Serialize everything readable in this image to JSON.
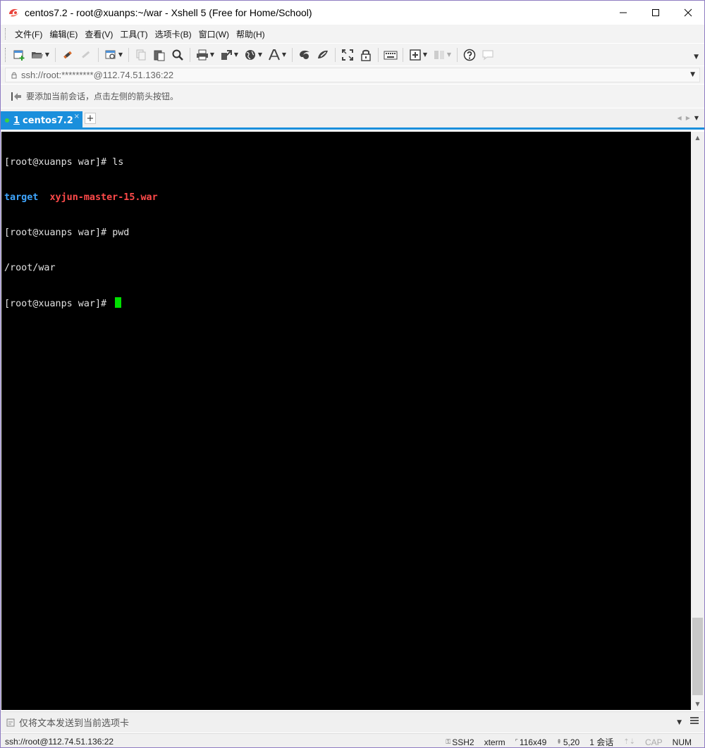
{
  "window": {
    "title": "centos7.2 - root@xuanps:~/war - Xshell 5 (Free for Home/School)"
  },
  "menu": {
    "items": [
      "文件(F)",
      "编辑(E)",
      "查看(V)",
      "工具(T)",
      "选项卡(B)",
      "窗口(W)",
      "帮助(H)"
    ]
  },
  "toolbar": {
    "icons": [
      "new-session-icon",
      "open-folder-icon",
      "connect-icon",
      "disconnect-icon",
      "properties-icon",
      "copy-icon",
      "paste-icon",
      "find-icon",
      "print-icon",
      "transfer-icon",
      "globe-icon",
      "font-icon",
      "xftp-icon",
      "xmanager-icon",
      "fullscreen-icon",
      "lock-icon",
      "keyboard-icon",
      "new-tab-icon",
      "layout-icon",
      "help-icon",
      "chat-icon"
    ]
  },
  "address": {
    "value": "ssh://root:*********@112.74.51.136:22"
  },
  "hint": {
    "text": "要添加当前会话，点击左侧的箭头按钮。"
  },
  "tabs": [
    {
      "number": "1",
      "label": "centos7.2",
      "close": "×",
      "active": true
    }
  ],
  "tab_add_label": "+",
  "terminal": {
    "lines": [
      {
        "prompt": "[root@xuanps war]# ",
        "command": "ls"
      },
      {
        "dir": "target",
        "gap": "  ",
        "file": "xyjun-master-15.war"
      },
      {
        "prompt": "[root@xuanps war]# ",
        "command": "pwd"
      },
      {
        "output": "/root/war"
      },
      {
        "prompt": "[root@xuanps war]# "
      }
    ]
  },
  "sendbar": {
    "text": "仅将文本发送到当前选项卡"
  },
  "status": {
    "connection": "ssh://root@112.74.51.136:22",
    "protocol": "SSH2",
    "terminal_type": "xterm",
    "size": "116x49",
    "cursor_pos": "5,20",
    "sessions": "1 会话",
    "cap": "CAP",
    "num": "NUM"
  },
  "colors": {
    "tab_accent": "#1a8fdc",
    "terminal_bg": "#000000",
    "dir_color": "#3fa6ff",
    "archive_color": "#ff4a4a",
    "cursor_color": "#00e000"
  }
}
